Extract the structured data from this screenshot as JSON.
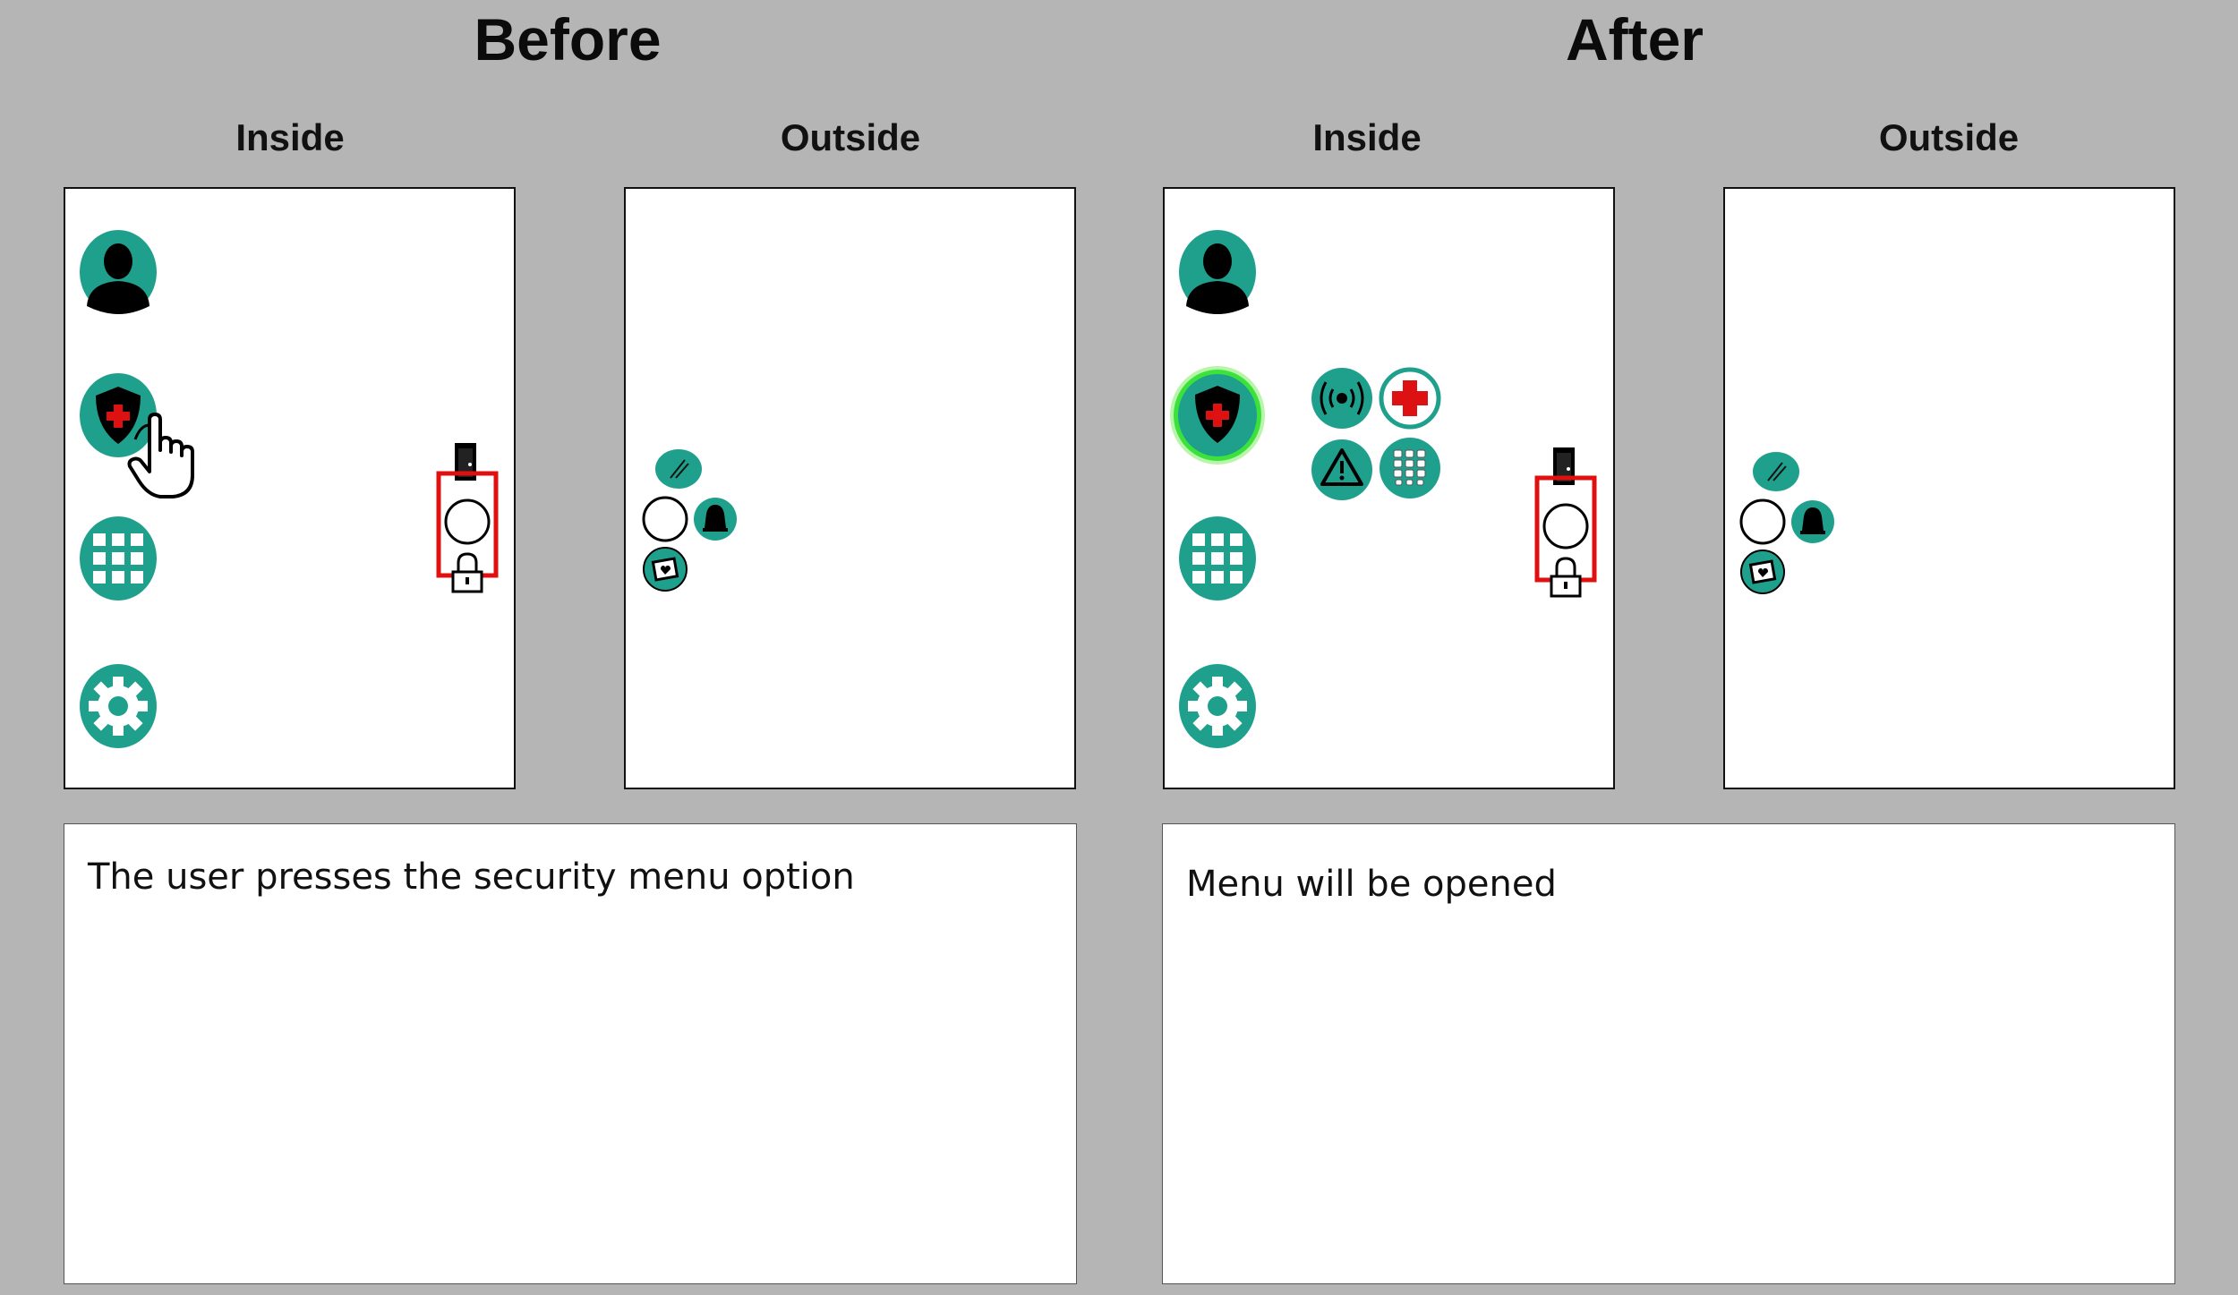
{
  "before": {
    "title": "Before",
    "inside_label": "Inside",
    "outside_label": "Outside",
    "description": "The user presses the security menu option"
  },
  "after": {
    "title": "After",
    "inside_label": "Inside",
    "outside_label": "Outside",
    "description": "Menu will be opened"
  },
  "icons": {
    "menu": [
      "person-icon",
      "security-shield-icon",
      "grid-apps-icon",
      "gear-icon"
    ],
    "submenu": [
      "alarm-broadcast-icon",
      "medical-cross-icon",
      "warning-triangle-icon",
      "keypad-icon"
    ],
    "outside": [
      "camera-icon",
      "doorbell-button-icon",
      "bell-icon",
      "intercom-icon"
    ],
    "door": [
      "door-icon",
      "ring-button-icon",
      "lock-icon"
    ],
    "cursor": "hand-pointer-icon"
  },
  "colors": {
    "background": "#b5b5b5",
    "teal": "#1fa08d",
    "highlight_glow": "#3be23b",
    "door_highlight": "#e01010",
    "medical_red": "#dd1111"
  }
}
